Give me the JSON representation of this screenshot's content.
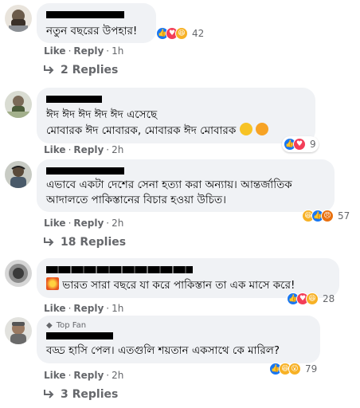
{
  "comments": [
    {
      "text_lines": [
        "নতুন বছরের উপহার!"
      ],
      "reactions": [
        "like",
        "love",
        "haha"
      ],
      "reaction_count": "42",
      "actions": {
        "like": "Like",
        "reply": "Reply",
        "time": "1h"
      },
      "replies_label": "2 Replies"
    },
    {
      "text_lines": [
        "ঈদ ঈদ ঈদ ঈদ ঈদ এসেছে",
        "মোবারক ঈদ মোবারক, মোবারক ঈদ মোবারক"
      ],
      "inline_emojis": [
        "smiley-icon",
        "grin-icon"
      ],
      "reactions": [
        "like",
        "love"
      ],
      "reaction_count": "9",
      "actions": {
        "like": "Like",
        "reply": "Reply",
        "time": "2h"
      }
    },
    {
      "text_lines": [
        "এভাবে একটা দেশের সেনা হত্যা করা অন্যায়। আন্তর্জাতিক",
        "আদালতে পাকিস্তানের বিচার হওয়া উচিত।"
      ],
      "reactions": [
        "haha",
        "like",
        "angry"
      ],
      "reaction_count": "57",
      "actions": {
        "like": "Like",
        "reply": "Reply",
        "time": "2h"
      },
      "replies_label": "18 Replies"
    },
    {
      "text_lines": [
        "ভারত সারা বছরে যা করে পাকিস্তান তা এক মাসে করে!"
      ],
      "leading_emoji": "collision-icon",
      "reactions": [
        "like",
        "love",
        "haha"
      ],
      "reaction_count": "28",
      "actions": {
        "like": "Like",
        "reply": "Reply",
        "time": "1h"
      }
    },
    {
      "badge": "Top Fan",
      "text_lines": [
        "বড্ড হাসি পেল। এতগুলি শয়তান একসাথে কে মারিল?"
      ],
      "reactions": [
        "like",
        "haha",
        "wow"
      ],
      "reaction_count": "79",
      "actions": {
        "like": "Like",
        "reply": "Reply",
        "time": "2h"
      },
      "replies_label": "3 Replies"
    }
  ],
  "colors": {
    "bubble": "#f0f2f5",
    "meta": "#65676b",
    "like": "#1877f2",
    "love": "#f33e58",
    "haha": "#f7b125"
  }
}
